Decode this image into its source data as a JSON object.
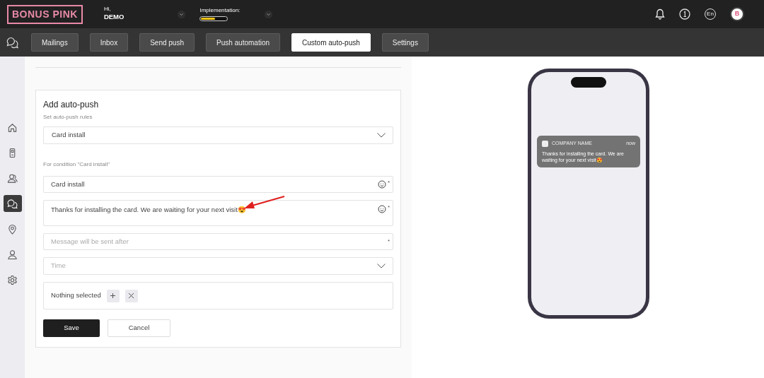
{
  "header": {
    "logo": "BONUS PINK",
    "greeting": "Hi,",
    "user": "DEMO",
    "implementation": {
      "label": "Implementation:",
      "level": 0.55
    },
    "language": "En",
    "avatar": "B"
  },
  "tabs": [
    {
      "label": "Mailings",
      "selected": false
    },
    {
      "label": "Inbox",
      "selected": false
    },
    {
      "label": "Send push",
      "selected": false
    },
    {
      "label": "Push automation",
      "selected": false
    },
    {
      "label": "Custom auto-push",
      "selected": true
    },
    {
      "label": "Settings",
      "selected": false
    }
  ],
  "sidebar": {
    "items": [
      {
        "kind": "home",
        "selected": false
      },
      {
        "kind": "device",
        "selected": false
      },
      {
        "kind": "users",
        "selected": false
      },
      {
        "kind": "chat",
        "selected": true
      },
      {
        "kind": "location",
        "selected": false
      },
      {
        "kind": "user",
        "selected": false
      },
      {
        "kind": "settings",
        "selected": false
      }
    ]
  },
  "form": {
    "title": "Add auto-push",
    "subtitle": "Set auto-push rules",
    "condition": "Card install",
    "condition_note": "For condition \"Card install\"",
    "fields": [
      {
        "kind": "text",
        "value": "Card install",
        "required_mark": "*",
        "emoji_picker": true
      },
      {
        "kind": "textarea",
        "value": "Thanks for installing the card. We are waiting for your next visit😍",
        "required_mark": "*",
        "emoji_picker": true
      },
      {
        "kind": "text",
        "placeholder": "Message will be sent after",
        "required_mark": "*",
        "emoji_picker": false
      },
      {
        "kind": "select",
        "placeholder": "Time",
        "emoji_picker": false
      },
      {
        "kind": "picker",
        "value": "Nothing selected",
        "emoji_picker": false
      }
    ],
    "buttons": [
      {
        "label": "Save",
        "kind": "primary"
      },
      {
        "label": "Cancel",
        "kind": "secondary"
      }
    ]
  },
  "preview": {
    "app_name": "COMPANY NAME",
    "time": "now",
    "message": "Thanks for installing the card. We are waiting for your next visit😍"
  }
}
